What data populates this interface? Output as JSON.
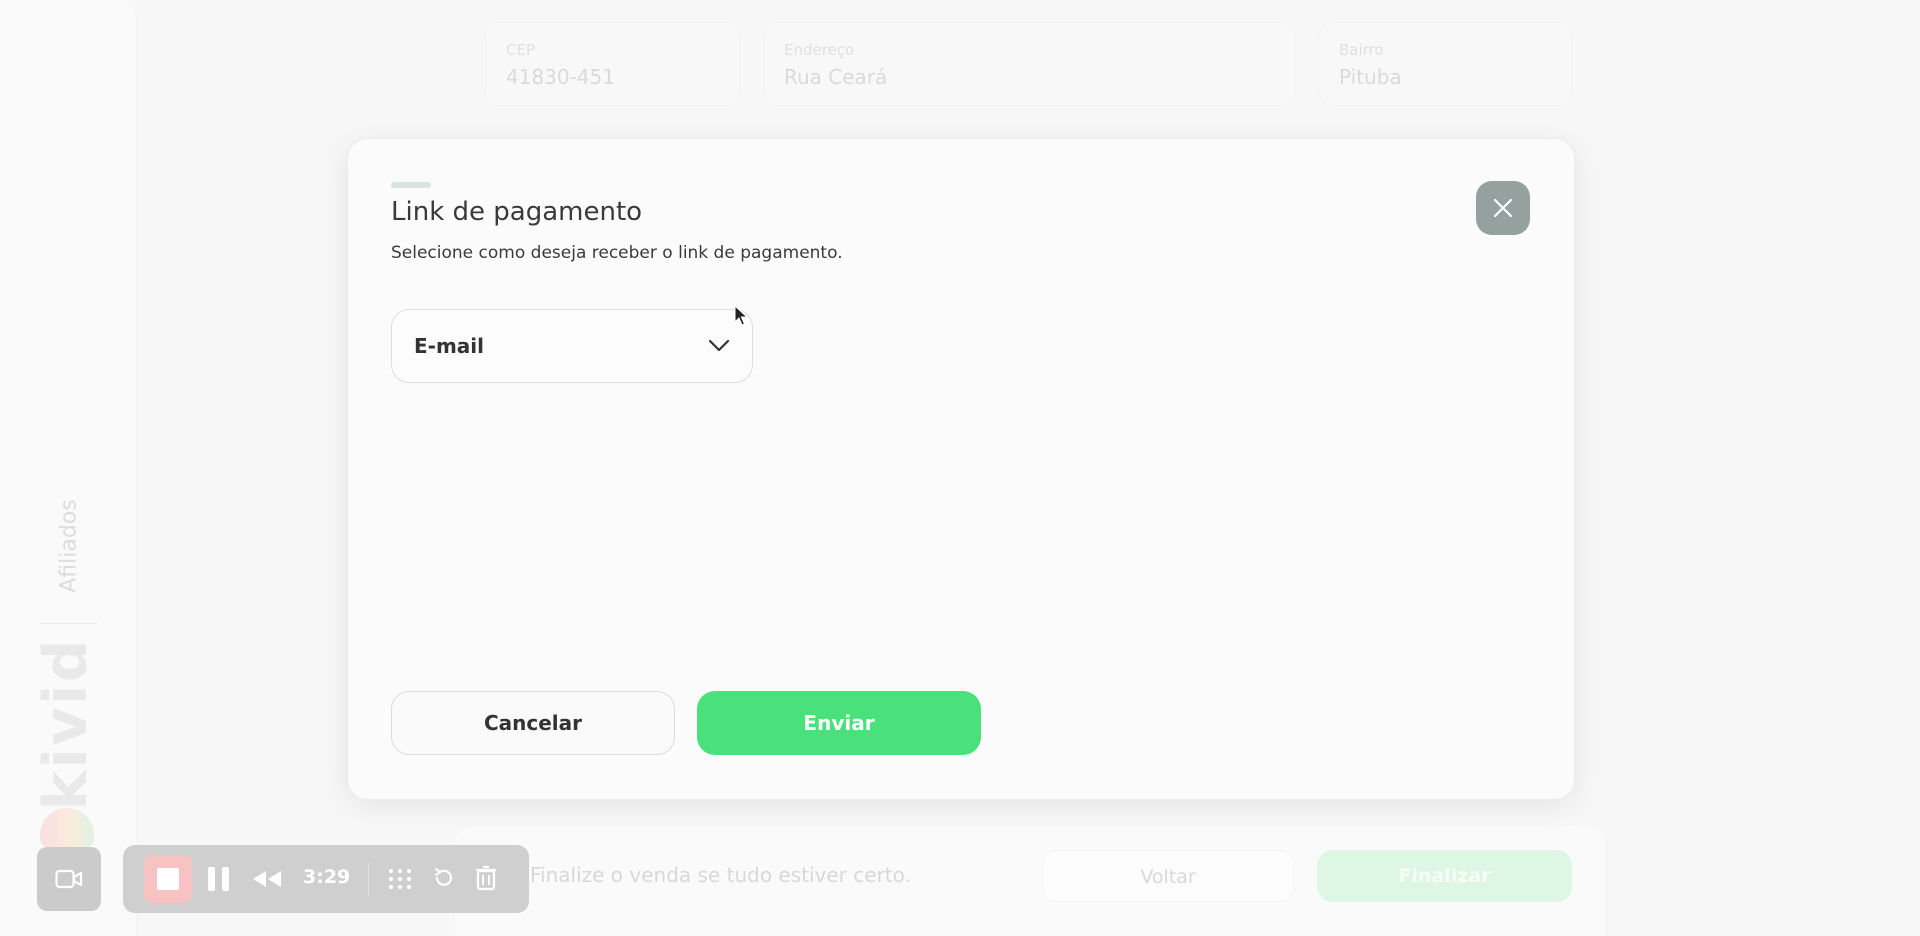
{
  "sidebar": {
    "nav_label": "Afiliados",
    "brand": "kivid"
  },
  "background_form": {
    "fields": [
      {
        "label": "CEP",
        "value": "41830-451"
      },
      {
        "label": "Endereço",
        "value": "Rua Ceará"
      },
      {
        "label": "Bairro",
        "value": "Pituba"
      }
    ],
    "footer_message": "Finalize o venda se tudo estiver certo.",
    "back_label": "Voltar",
    "finish_label": "Finalizar"
  },
  "recorder": {
    "time": "3:29",
    "icons": [
      "camera-icon",
      "stop-icon",
      "pause-icon",
      "rewind-icon",
      "grid-icon",
      "restart-icon",
      "trash-icon"
    ]
  },
  "modal": {
    "title": "Link de pagamento",
    "subtitle": "Selecione como deseja receber o link de pagamento.",
    "select_value": "E-mail",
    "cancel_label": "Cancelar",
    "send_label": "Enviar",
    "close_icon": "close-icon"
  },
  "colors": {
    "accent_green": "#4ae07c",
    "close_button": "#95a19f",
    "recorder_stop": "#f2a2a2"
  }
}
